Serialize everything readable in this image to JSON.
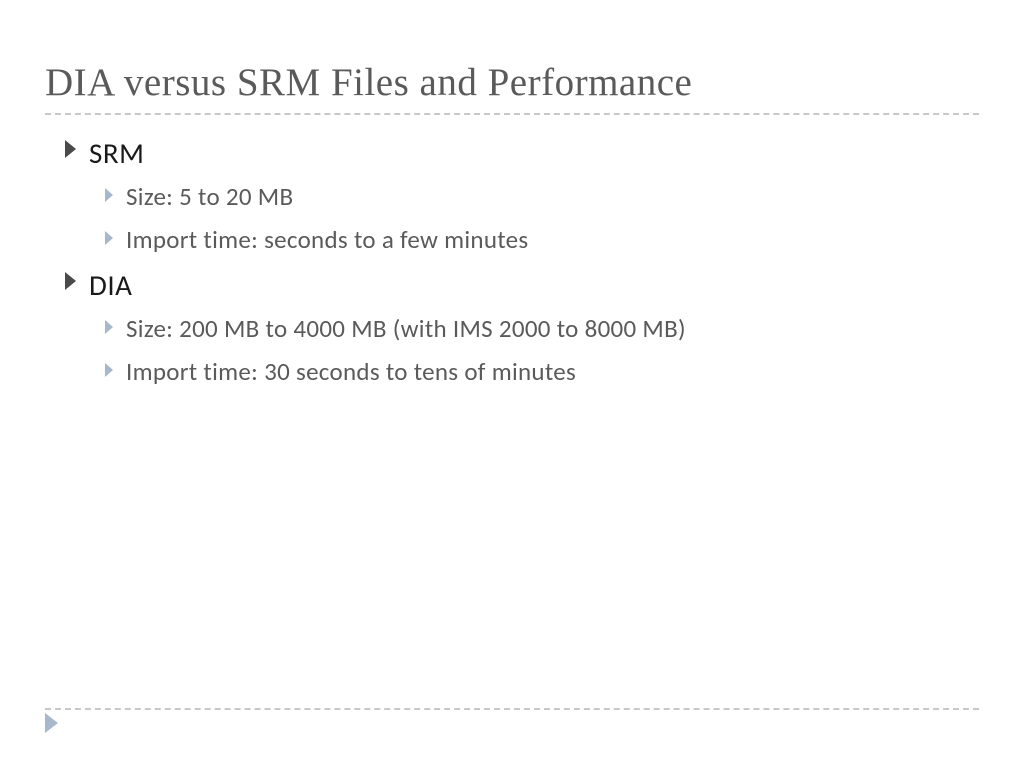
{
  "title": "DIA versus SRM Files and Performance",
  "sections": [
    {
      "heading": "SRM",
      "items": [
        "Size: 5 to 20 MB",
        "Import time: seconds to a few minutes"
      ]
    },
    {
      "heading": "DIA",
      "items": [
        "Size: 200 MB to 4000 MB (with IMS 2000 to 8000 MB)",
        "Import time: 30 seconds to tens of minutes"
      ]
    }
  ],
  "colors": {
    "bullet_dark": "#4a4a4a",
    "bullet_light": "#a8b8cc",
    "text_heading": "#1a1a1a",
    "text_body": "#5a5a5a"
  }
}
